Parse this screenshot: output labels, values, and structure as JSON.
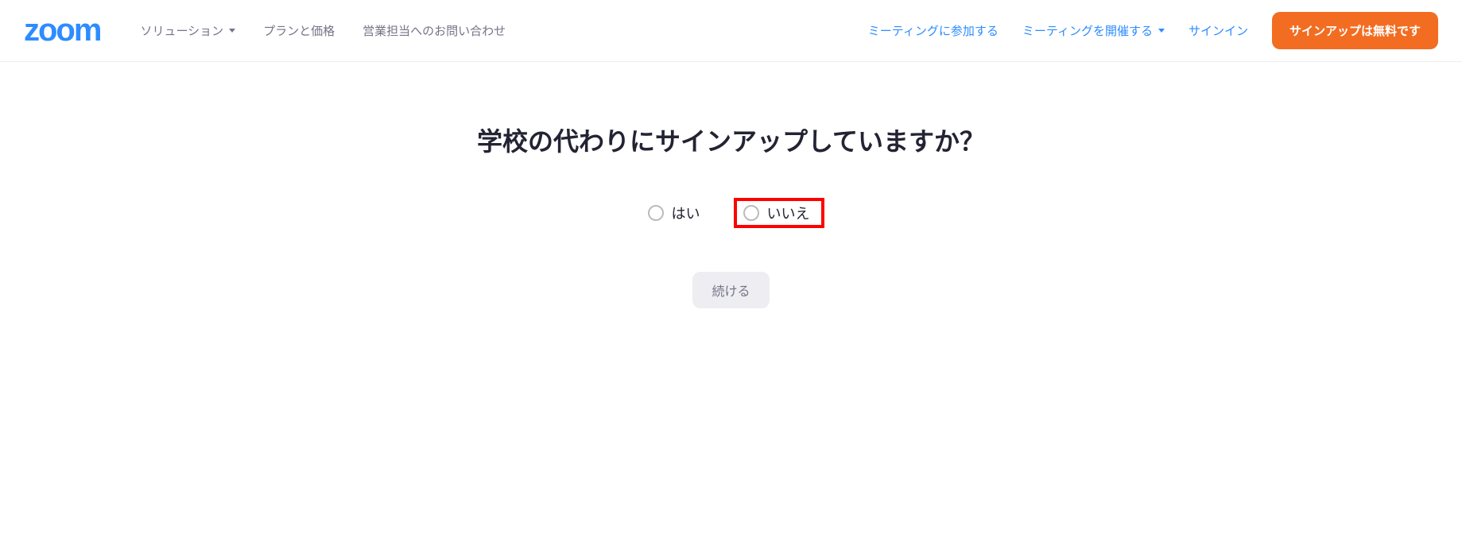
{
  "header": {
    "logo": "zoom",
    "nav_left": {
      "solutions": "ソリューション",
      "plans_pricing": "プランと価格",
      "contact_sales": "営業担当へのお問い合わせ"
    },
    "nav_right": {
      "join_meeting": "ミーティングに参加する",
      "host_meeting": "ミーティングを開催する",
      "sign_in": "サインイン",
      "sign_up_free": "サインアップは無料です"
    }
  },
  "main": {
    "question": "学校の代わりにサインアップしていますか？",
    "option_yes": "はい",
    "option_no": "いいえ",
    "continue_label": "続ける"
  }
}
